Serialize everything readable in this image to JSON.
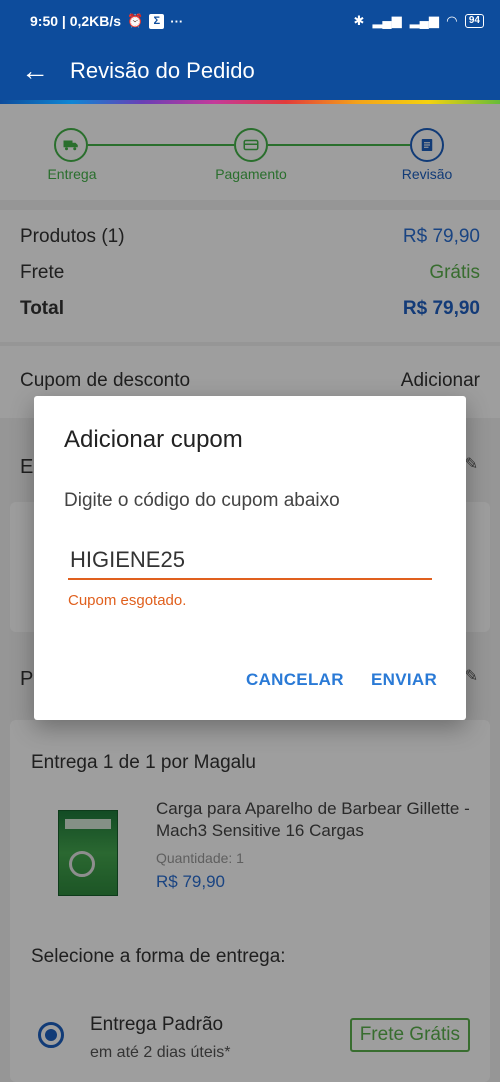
{
  "status_bar": {
    "time_speed": "9:50 | 0,2KB/s",
    "battery": "94"
  },
  "app_bar": {
    "title": "Revisão do Pedido"
  },
  "stepper": {
    "steps": [
      {
        "label": "Entrega",
        "state": "done"
      },
      {
        "label": "Pagamento",
        "state": "done"
      },
      {
        "label": "Revisão",
        "state": "current"
      }
    ],
    "colors": {
      "done": "#45b34a",
      "current": "#1c5fc0"
    }
  },
  "summary": {
    "products_label": "Produtos (1)",
    "products_value": "R$ 79,90",
    "shipping_label": "Frete",
    "shipping_value": "Grátis",
    "total_label": "Total",
    "total_value": "R$ 79,90"
  },
  "coupon": {
    "label": "Cupom de desconto",
    "action": "Adicionar"
  },
  "sections": {
    "address_initial": "E",
    "products_initial": "P"
  },
  "product_card": {
    "delivery_header": "Entrega 1 de 1 por Magalu",
    "product_name": "Carga para Aparelho de Barbear Gillette - Mach3 Sensitive 16 Cargas",
    "quantity": "Quantidade:  1",
    "price": "R$ 79,90",
    "shipping_title": "Selecione a forma de entrega:",
    "shipping_option": {
      "name": "Entrega Padrão",
      "days": "em até 2 dias úteis*",
      "badge": "Frete Grátis"
    }
  },
  "dialog": {
    "title": "Adicionar cupom",
    "message": "Digite o código do cupom abaixo",
    "input_value": "HIGIENE25",
    "error": "Cupom esgotado.",
    "cancel_label": "CANCELAR",
    "submit_label": "ENVIAR"
  }
}
